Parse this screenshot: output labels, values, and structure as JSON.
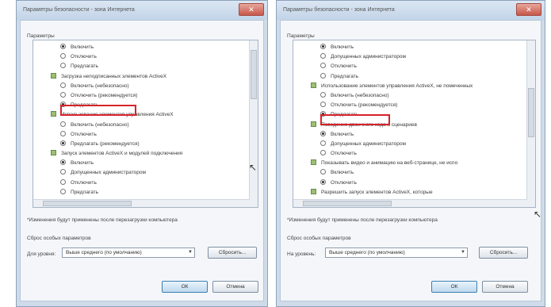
{
  "left_dialog": {
    "title": "Параметры безопасности - зона Интернета",
    "section_label": "Параметры",
    "tree": [
      {
        "type": "radio",
        "label": "Включить",
        "selected": true,
        "level": 1
      },
      {
        "type": "radio",
        "label": "Отключить",
        "selected": false,
        "level": 1
      },
      {
        "type": "radio",
        "label": "Предлагать",
        "selected": false,
        "level": 1
      },
      {
        "type": "group",
        "label": "Загрузка неподписанных элементов ActiveX",
        "level": 0
      },
      {
        "type": "radio",
        "label": "Включить (небезопасно)",
        "selected": false,
        "level": 1
      },
      {
        "type": "radio",
        "label": "Отключить (рекомендуется)",
        "selected": false,
        "level": 1
      },
      {
        "type": "radio",
        "label": "Предлагать",
        "selected": true,
        "level": 1,
        "highlighted": true
      },
      {
        "type": "group",
        "label": "Использование элементов управления ActiveX",
        "level": 0
      },
      {
        "type": "radio",
        "label": "Включить (небезопасно)",
        "selected": false,
        "level": 1
      },
      {
        "type": "radio",
        "label": "Отключить",
        "selected": false,
        "level": 1
      },
      {
        "type": "radio",
        "label": "Предлагать (рекомендуется)",
        "selected": true,
        "level": 1
      },
      {
        "type": "group",
        "label": "Запуск элементов ActiveX и модулей подключения",
        "level": 0
      },
      {
        "type": "radio",
        "label": "Включить",
        "selected": true,
        "level": 1
      },
      {
        "type": "radio",
        "label": "Допущенных администратором",
        "selected": false,
        "level": 1
      },
      {
        "type": "radio",
        "label": "Отключить",
        "selected": false,
        "level": 1
      },
      {
        "type": "radio",
        "label": "Предлагать",
        "selected": false,
        "level": 1
      }
    ],
    "note": "*Изменения будут применены после перезагрузки компьютера",
    "reset_label": "Сброс особых параметров",
    "reset_for_label": "Для уровня:",
    "reset_level_value": "Выше среднего (по умолчанию)",
    "reset_button": "Сбросить...",
    "ok_button": "ОК",
    "cancel_button": "Отмена"
  },
  "right_dialog": {
    "title": "Параметры безопасности - зона Интернета",
    "section_label": "Параметры",
    "tree": [
      {
        "type": "radio",
        "label": "Включить",
        "selected": true,
        "level": 1
      },
      {
        "type": "radio",
        "label": "Допущенных администратором",
        "selected": false,
        "level": 1
      },
      {
        "type": "radio",
        "label": "Отключить",
        "selected": false,
        "level": 1
      },
      {
        "type": "radio",
        "label": "Предлагать",
        "selected": false,
        "level": 1
      },
      {
        "type": "group",
        "label": "Использование элементов управления ActiveX, не помеченных",
        "level": 0
      },
      {
        "type": "radio",
        "label": "Включить (небезопасно)",
        "selected": false,
        "level": 1
      },
      {
        "type": "radio",
        "label": "Отключить (рекомендуется)",
        "selected": false,
        "level": 1
      },
      {
        "type": "radio",
        "label": "Предлагать",
        "selected": true,
        "level": 1,
        "highlighted": true
      },
      {
        "type": "group",
        "label": "Поведение двоичного кода и сценариев",
        "level": 0
      },
      {
        "type": "radio",
        "label": "Включить",
        "selected": true,
        "level": 1
      },
      {
        "type": "radio",
        "label": "Допущенных администратором",
        "selected": false,
        "level": 1
      },
      {
        "type": "radio",
        "label": "Отключить",
        "selected": false,
        "level": 1
      },
      {
        "type": "group",
        "label": "Показывать видео и анимацию на веб-странице, не испо",
        "level": 0
      },
      {
        "type": "radio",
        "label": "Включить",
        "selected": false,
        "level": 1
      },
      {
        "type": "radio",
        "label": "Отключить",
        "selected": true,
        "level": 1
      },
      {
        "type": "group",
        "label": "Разрешить запуск элементов ActiveX, которые",
        "level": 0
      }
    ],
    "note": "*Изменения будут применены после перезагрузки компьютера",
    "reset_label": "Сброс особых параметров",
    "reset_for_label": "На уровень:",
    "reset_level_value": "Выше среднего (по умолчанию)",
    "reset_button": "Сбросить...",
    "ok_button": "ОК",
    "cancel_button": "Отмена"
  },
  "colors": {
    "highlight_box": "#d8232a",
    "close_button": "#c7574a",
    "window_frame": "#cfdbe9"
  },
  "icons": [
    "close-icon",
    "radio-icon",
    "setting-group-icon",
    "dropdown-arrow-icon",
    "mouse-cursor-icon"
  ]
}
